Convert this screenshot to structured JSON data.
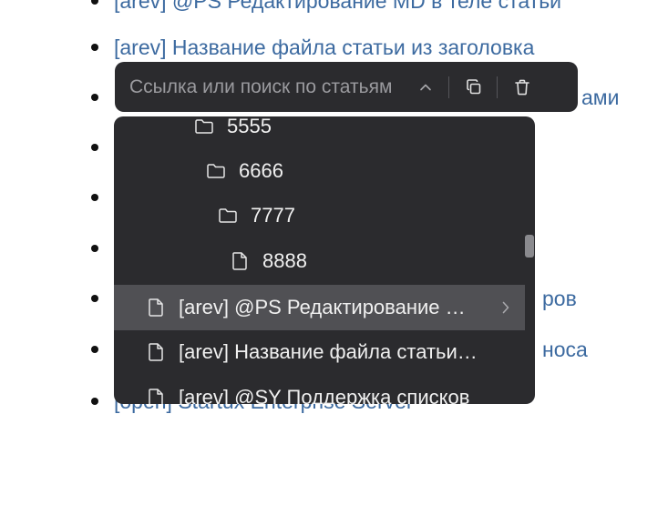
{
  "background_list": [
    "[arev] @PS Редактирование MD в теле статьи",
    "[arev] Название файла статьи из заголовка",
    "ами",
    "",
    "",
    "",
    "ров",
    "носа",
    "[open] Startux Enterprise Server"
  ],
  "toolbar": {
    "search_placeholder": "Ссылка или поиск по статьям",
    "search_value": "",
    "collapse_icon": "chevron-up-icon",
    "copy_icon": "copy-icon",
    "delete_icon": "trash-icon"
  },
  "dropdown": {
    "items": [
      {
        "label": "5555",
        "icon": "folder-icon"
      },
      {
        "label": "6666",
        "icon": "folder-icon"
      },
      {
        "label": "7777",
        "icon": "folder-icon"
      },
      {
        "label": "8888",
        "icon": "file-icon"
      },
      {
        "label": "[arev] @PS Редактирование MD в теле статьи",
        "icon": "file-icon",
        "selected": true,
        "submenu_icon": "chevron-right-icon"
      },
      {
        "label": "[arev] Название файла статьи из заголовка",
        "icon": "file-icon"
      },
      {
        "label": "[arev] @SY Поддержка списков",
        "icon": "file-icon"
      }
    ]
  },
  "colors": {
    "panel_bg": "#2b2b2e",
    "selected_row_bg": "#505054",
    "link_color": "#3c6aa0",
    "text_color": "#f0f0f0"
  }
}
